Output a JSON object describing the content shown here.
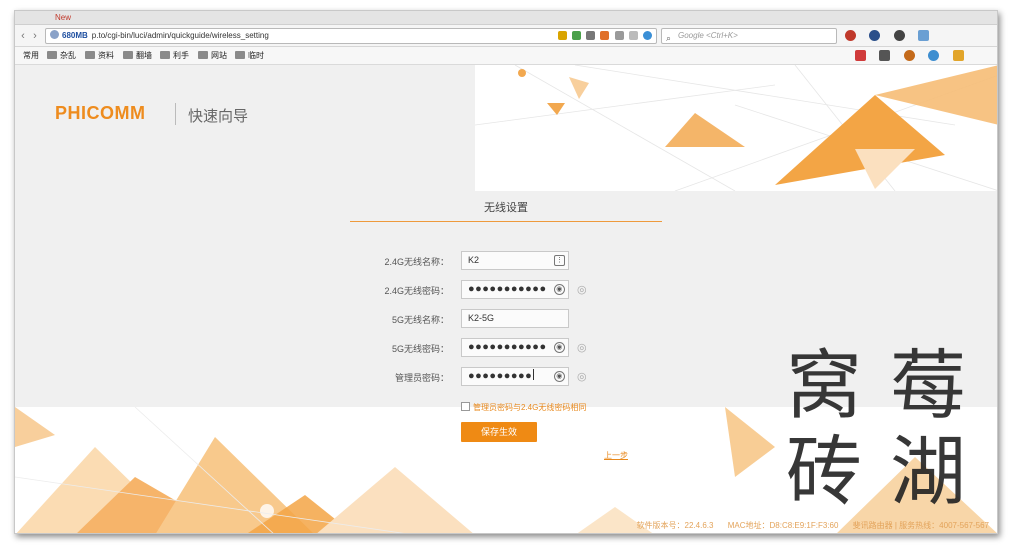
{
  "browser": {
    "tab_label": "New",
    "memory": "680MB",
    "url": "p.to/cgi-bin/luci/admin/quickguide/wireless_setting",
    "search_placeholder": "Google <Ctrl+K>",
    "bookmarks": [
      "常用",
      "杂乱",
      "资料",
      "翻墙",
      "利手",
      "网站",
      "临时"
    ]
  },
  "brand": {
    "logo": "PHICOMM",
    "subtitle": "快速向导",
    "accent": "#ee8c1e"
  },
  "form": {
    "title": "无线设置",
    "fields": [
      {
        "label": "2.4G无线名称：",
        "value": "K2"
      },
      {
        "label": "2.4G无线密码：",
        "value": "●●●●●●●●●●●"
      },
      {
        "label": "5G无线名称：",
        "value": "K2-5G"
      },
      {
        "label": "5G无线密码：",
        "value": "●●●●●●●●●●●"
      },
      {
        "label": "管理员密码：",
        "value": "●●●●●●●●●"
      }
    ],
    "sync_label": "管理员密码与2.4G无线密码相同",
    "save_label": "保存生效",
    "prev_label": "上一步"
  },
  "footer": {
    "version": "软件版本号：22.4.6.3",
    "mac": "MAC地址：D8:C8:E9:1F:F3:60",
    "hotline": "斐讯路由器 | 服务热线：4007-567-567"
  },
  "watermark": "窝莓 砖湖"
}
